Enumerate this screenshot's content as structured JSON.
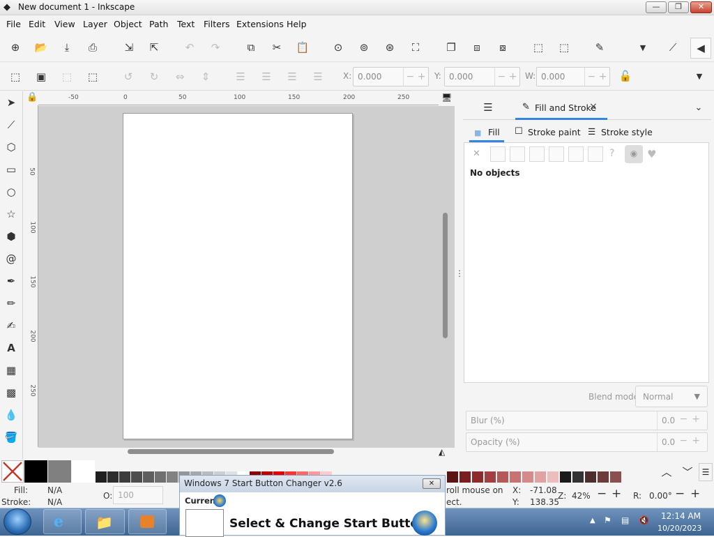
{
  "window": {
    "title": "New document 1 - Inkscape",
    "min": "—",
    "max": "❐",
    "close": "✕"
  },
  "menu": [
    "File",
    "Edit",
    "View",
    "Layer",
    "Object",
    "Path",
    "Text",
    "Filters",
    "Extensions",
    "Help"
  ],
  "coords": {
    "x_label": "X:",
    "x_value": "0.000",
    "y_label": "Y:",
    "y_value": "0.000",
    "w_label": "W:",
    "w_value": "0.000"
  },
  "ruler": {
    "h": [
      "-50",
      "0",
      "50",
      "100",
      "150",
      "200",
      "250"
    ],
    "v": [
      "50",
      "100",
      "150",
      "200",
      "250"
    ]
  },
  "panel": {
    "tab_label": "Fill and Stroke",
    "tab_close": "×",
    "subtabs": {
      "fill": "Fill",
      "stroke_paint": "Stroke paint",
      "stroke_style": "Stroke style"
    },
    "no_objects": "No objects",
    "blend_label": "Blend mode:",
    "blend_value": "Normal",
    "blur_label": "Blur (%)",
    "blur_value": "0.0",
    "opacity_label": "Opacity (%)",
    "opacity_value": "0.0"
  },
  "palette_colors": [
    "#1f1f1f",
    "#2e2e2e",
    "#3d3d3d",
    "#4d4d4d",
    "#5e5e5e",
    "#707070",
    "#828282",
    "#959595",
    "#a8a8a8",
    "#bbbbbb",
    "#cecece",
    "#e0e0e0",
    "#ffffff",
    "#8b0000",
    "#c00000",
    "#e60000",
    "#ff3333",
    "#ff6666",
    "#ff9999",
    "#ffcccc"
  ],
  "palette_right": [
    "#5a1414",
    "#7a1f1f",
    "#8b2b2b",
    "#a04040",
    "#b35959",
    "#c77373",
    "#d48a8a",
    "#e0a3a3",
    "#ecbdbd",
    "#1a1a1a",
    "#333333",
    "#4d2e2e",
    "#6e3b3b",
    "#8a4f4f"
  ],
  "status": {
    "fill_label": "Fill:",
    "fill_value": "N/A",
    "stroke_label": "Stroke:",
    "stroke_value": "N/A",
    "opacity_label": "O:",
    "opacity_value": "100",
    "hint": "roll mouse on",
    "hint2": "ect.",
    "x_label": "X:",
    "x_value": "-71.08",
    "y_label": "Y:",
    "y_value": "138.35",
    "zoom_label": "Z:",
    "zoom_value": "42%",
    "rot_label": "R:",
    "rot_value": "0.00°"
  },
  "dialog": {
    "title": "Windows 7 Start Button Changer v2.6",
    "current": "Current",
    "heading": "Select & Change Start Button"
  },
  "taskbar": {
    "time": "12:14 AM",
    "date": "10/20/2023"
  }
}
